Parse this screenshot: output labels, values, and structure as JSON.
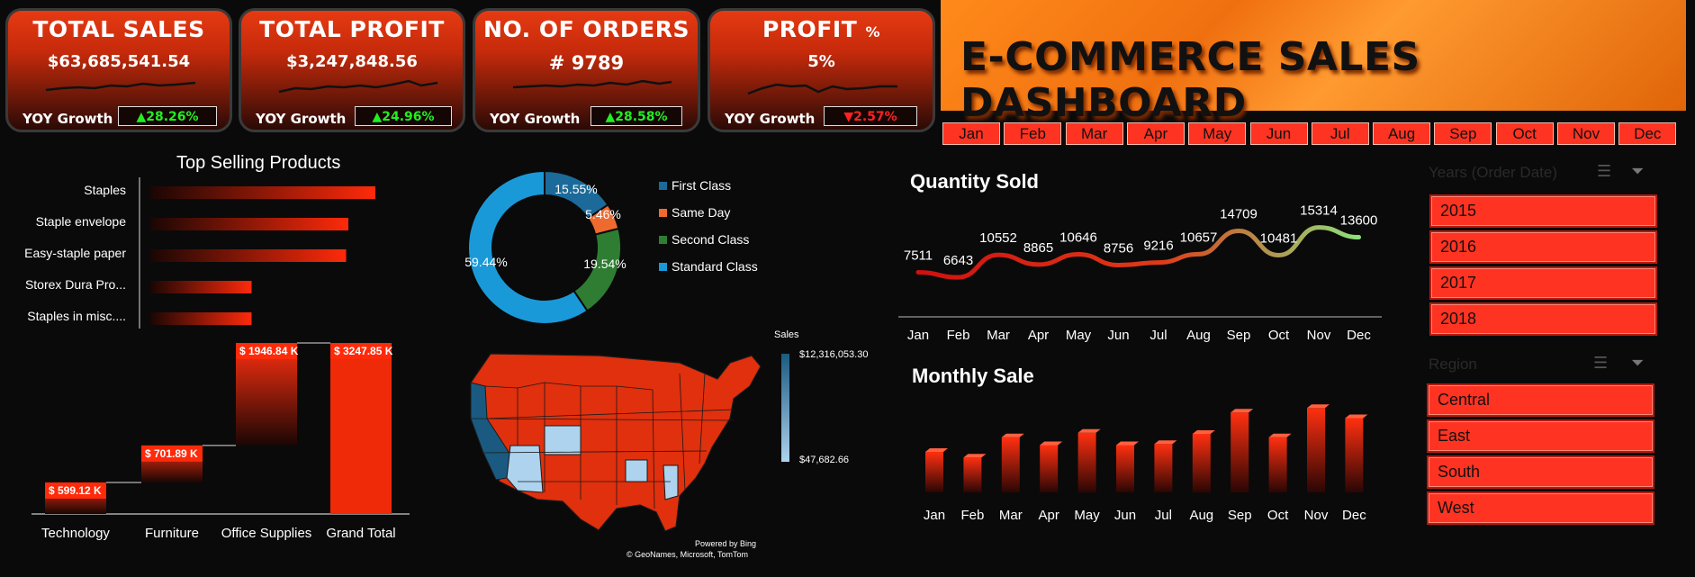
{
  "kpis": [
    {
      "title": "TOTAL SALES",
      "value": "$63,685,541.54",
      "yoy_label": "YOY Growth",
      "yoy": "▲28.26%",
      "dir": "up"
    },
    {
      "title": "TOTAL PROFIT",
      "value": "$3,247,848.56",
      "yoy_label": "YOY Growth",
      "yoy": "▲24.96%",
      "dir": "up"
    },
    {
      "title": "NO. OF ORDERS",
      "value": "# 9789",
      "yoy_label": "YOY Growth",
      "yoy": "▲28.58%",
      "dir": "up"
    },
    {
      "title": "PROFIT",
      "title_suffix": "%",
      "value": "5%",
      "yoy_label": "YOY Growth",
      "yoy": "▼2.57%",
      "dir": "down"
    }
  ],
  "banner": {
    "title": "E-COMMERCE SALES DASHBOARD"
  },
  "months": [
    "Jan",
    "Feb",
    "Mar",
    "Apr",
    "May",
    "Jun",
    "Jul",
    "Aug",
    "Sep",
    "Oct",
    "Nov",
    "Dec"
  ],
  "years_slicer": {
    "header": "Years (Order Date)",
    "items": [
      "2015",
      "2016",
      "2017",
      "2018"
    ]
  },
  "region_slicer": {
    "header": "Region",
    "items": [
      "Central",
      "East",
      "South",
      "West"
    ]
  },
  "colors": {
    "accent": "#ff3322",
    "positive": "#22ee22",
    "negative": "#ff2222",
    "dark_blue": "#1a5a80",
    "light_blue": "#aed3ee"
  },
  "chart_data": [
    {
      "type": "bar",
      "title": "Top Selling Products",
      "categories": [
        "Staples",
        "Staple envelope",
        "Easy-staple paper",
        "Storex Dura Pro...",
        "Staples in misc...."
      ],
      "values": [
        100,
        88,
        87,
        45,
        45
      ]
    },
    {
      "type": "pie",
      "variant": "donut",
      "labels": [
        "First Class",
        "Same Day",
        "Second Class",
        "Standard Class"
      ],
      "values": [
        15.55,
        5.46,
        19.54,
        59.44
      ],
      "value_labels": [
        "15.55%",
        "5.46%",
        "19.54%",
        "59.44%"
      ],
      "colors": [
        "#1b6a99",
        "#ef6a2e",
        "#2e7d32",
        "#1a99d8"
      ]
    },
    {
      "type": "bar",
      "variant": "waterfall",
      "categories": [
        "Technology",
        "Furniture",
        "Office Supplies",
        "Grand Total"
      ],
      "values": [
        599.12,
        701.89,
        1946.84,
        3247.85
      ],
      "value_labels": [
        "$ 599.12 K",
        "$ 701.89 K",
        "$ 1946.84 K",
        "$ 3247.85 K"
      ]
    },
    {
      "type": "line",
      "title": "Quantity Sold",
      "categories": [
        "Jan",
        "Feb",
        "Mar",
        "Apr",
        "May",
        "Jun",
        "Jul",
        "Aug",
        "Sep",
        "Oct",
        "Nov",
        "Dec"
      ],
      "values": [
        7511,
        6643,
        10552,
        8865,
        10646,
        8756,
        9216,
        10657,
        14709,
        10481,
        15314,
        13600
      ]
    },
    {
      "type": "bar",
      "title": "Monthly Sale",
      "categories": [
        "Jan",
        "Feb",
        "Mar",
        "Apr",
        "May",
        "Jun",
        "Jul",
        "Aug",
        "Sep",
        "Oct",
        "Nov",
        "Dec"
      ],
      "values": [
        3.6,
        3.1,
        4.9,
        4.2,
        5.3,
        4.2,
        4.3,
        5.2,
        7.1,
        4.9,
        7.5,
        6.6
      ]
    }
  ],
  "map": {
    "legend_title": "Sales",
    "legend_max": "$12,316,053.30",
    "legend_min": "$47,682.66",
    "credit1": "Powered by Bing",
    "credit2": "© GeoNames, Microsoft, TomTom"
  }
}
